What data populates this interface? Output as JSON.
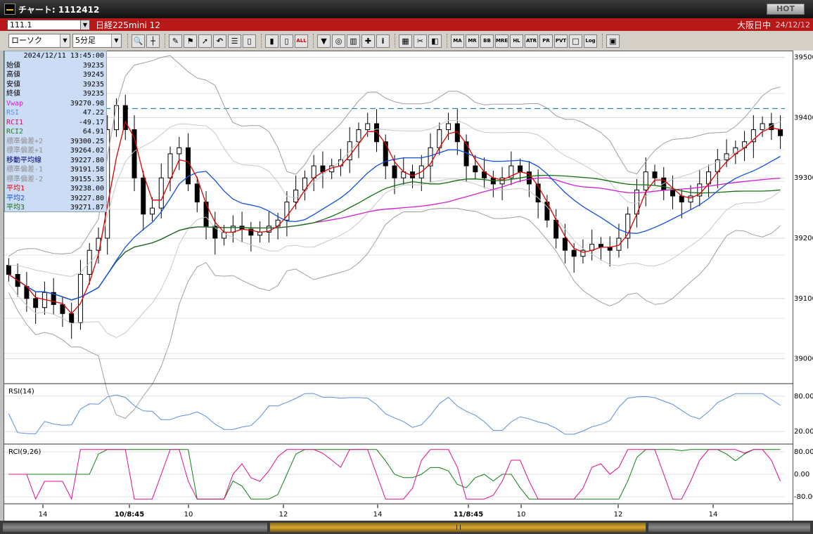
{
  "window": {
    "title": "チャート: 1112412",
    "hot_label": "HOT"
  },
  "symbol_bar": {
    "code": "111.1",
    "name": "日経225mini 12",
    "market": "大阪日中",
    "date": "24/12/12"
  },
  "toolbar": {
    "chart_type": "ローソク",
    "interval": "5分足",
    "buttons": [
      "zoom-icon",
      "cursor-cross-icon",
      "pen-icon",
      "draw-tool-icon",
      "arrow-icon",
      "undo-icon",
      "notes-icon",
      "trash-icon",
      "candle-a-icon",
      "candle-b-icon",
      "ALL",
      "drop-icon",
      "magnifier-icon",
      "bar-icon",
      "pin-icon",
      "info-icon",
      "palette-icon",
      "tool-icon",
      "rainbow-icon",
      "MA",
      "MR",
      "BB",
      "MRE",
      "HL",
      "ATR",
      "PR",
      "PVT",
      "box-icon",
      "Log",
      "save-icon"
    ]
  },
  "info": {
    "timestamp": "2024/12/11  13:45:00",
    "rows": [
      {
        "label": "始値",
        "value": "39235",
        "color": "#000000"
      },
      {
        "label": "高値",
        "value": "39245",
        "color": "#000000"
      },
      {
        "label": "安値",
        "value": "39235",
        "color": "#000000"
      },
      {
        "label": "終値",
        "value": "39235",
        "color": "#000000"
      },
      {
        "label": "Vwap",
        "value": "39270.98",
        "color": "#d020d0"
      },
      {
        "label": "RSI",
        "value": "47.22",
        "color": "#5a8ee0"
      },
      {
        "label": "RCI1",
        "value": "-49.17",
        "color": "#d01060"
      },
      {
        "label": "RCI2",
        "value": "64.91",
        "color": "#208020"
      },
      {
        "label": "標準偏差+2",
        "value": "39300.25",
        "color": "#909090"
      },
      {
        "label": "標準偏差+1",
        "value": "39264.02",
        "color": "#909090"
      },
      {
        "label": "移動平均線",
        "value": "39227.80",
        "color": "#000080"
      },
      {
        "label": "標準偏差-1",
        "value": "39191.58",
        "color": "#909090"
      },
      {
        "label": "標準偏差-2",
        "value": "39155.35",
        "color": "#909090"
      },
      {
        "label": "平均1",
        "value": "39238.00",
        "color": "#e00000"
      },
      {
        "label": "平均2",
        "value": "39227.80",
        "color": "#1050e0"
      },
      {
        "label": "平均3",
        "value": "39271.87",
        "color": "#107010"
      }
    ]
  },
  "price_axis": {
    "ticks": [
      "39500",
      "39400",
      "39300",
      "39200",
      "39100",
      "39000"
    ]
  },
  "rsi_panel": {
    "label": "RSI(14)",
    "ticks": [
      "80.00",
      "20.00"
    ]
  },
  "rci_panel": {
    "label": "RCI(9,26)",
    "ticks": [
      "80.00",
      "0.00",
      "-80.00"
    ]
  },
  "time_axis": {
    "ticks": [
      "14",
      "10/8:45",
      "10",
      "12",
      "14",
      "11/8:45",
      "10",
      "12",
      "14"
    ]
  },
  "chart_data": {
    "type": "candlestick",
    "ylim": [
      38960,
      39510
    ],
    "dashed_level": 39415,
    "close_estimates": [
      39140,
      39120,
      39100,
      39085,
      39110,
      39090,
      39075,
      39060,
      39140,
      39180,
      39200,
      39380,
      39420,
      39380,
      39300,
      39240,
      39250,
      39300,
      39340,
      39350,
      39290,
      39260,
      39220,
      39200,
      39210,
      39220,
      39215,
      39205,
      39210,
      39220,
      39230,
      39260,
      39280,
      39300,
      39320,
      39310,
      39320,
      39330,
      39360,
      39380,
      39390,
      39360,
      39320,
      39300,
      39310,
      39300,
      39320,
      39350,
      39380,
      39390,
      39360,
      39320,
      39310,
      39300,
      39290,
      39300,
      39320,
      39310,
      39290,
      39260,
      39230,
      39200,
      39180,
      39170,
      39180,
      39190,
      39185,
      39180,
      39200,
      39240,
      39280,
      39310,
      39300,
      39280,
      39270,
      39260,
      39270,
      39290,
      39310,
      39330,
      39340,
      39350,
      39360,
      39380,
      39390,
      39380,
      39370
    ]
  },
  "colors": {
    "titlebar": "#1a1a1a",
    "symbol_bar": "#b81818",
    "toolbar": "#d4d0c8",
    "bb": "#a0a0a0",
    "ma_short": "#e00000",
    "ma_mid": "#1050e0",
    "ma_long": "#107010",
    "vwap": "#d020d0",
    "rsi": "#5a8ee0",
    "rci1": "#e0108c",
    "rci2": "#108010",
    "dashed": "#2a8a9a",
    "accent_gold": "#d8a830"
  }
}
